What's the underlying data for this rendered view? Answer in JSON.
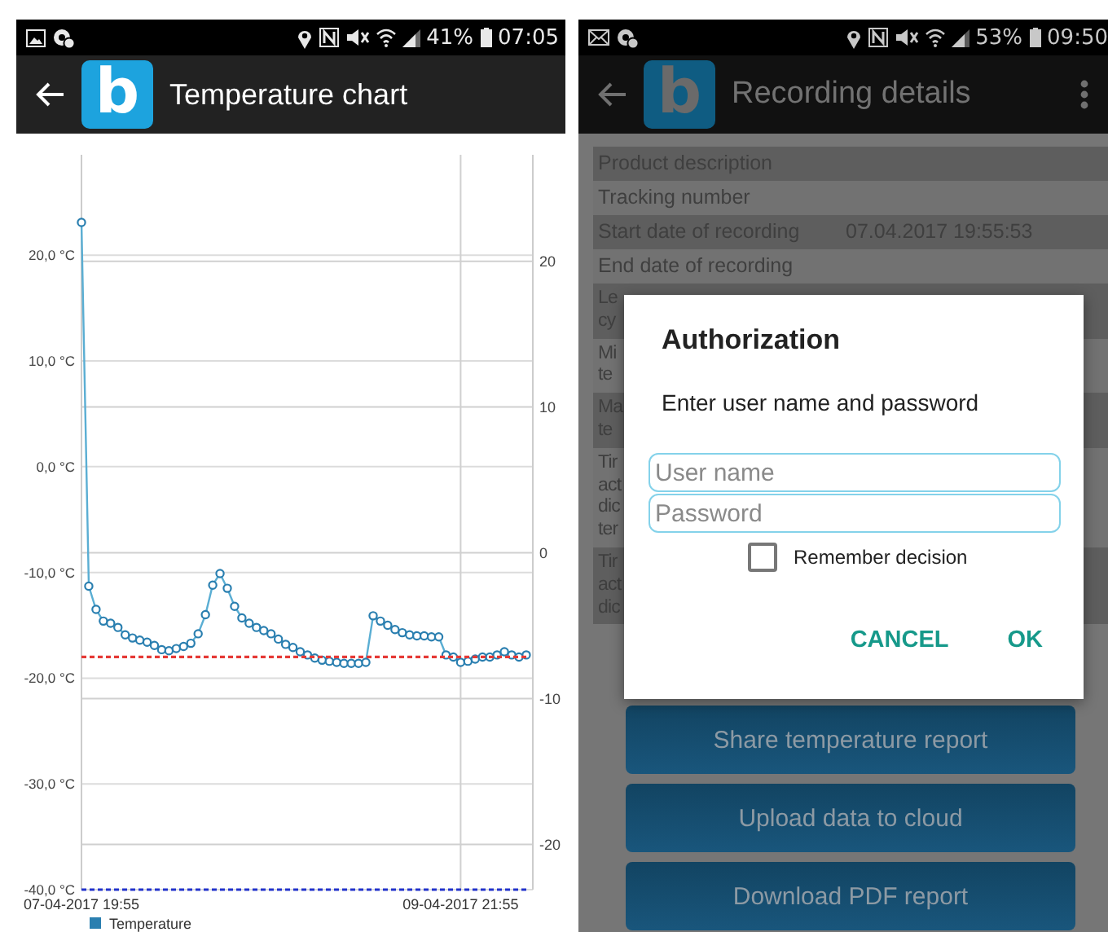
{
  "screens": [
    {
      "kind": "chart",
      "status_bar": {
        "battery": "41%",
        "time": "07:05"
      },
      "app_bar": {
        "title": "Temperature chart",
        "logo": "b"
      },
      "chart": {
        "chart_data": {
          "type": "line",
          "categories": [
            "07-04-2017 19:55",
            null,
            null,
            null,
            null,
            null,
            null,
            null,
            null,
            null,
            null,
            null,
            null,
            null,
            null,
            null,
            null,
            null,
            null,
            null,
            null,
            null,
            null,
            null,
            null,
            null,
            null,
            null,
            null,
            null,
            null,
            null,
            null,
            null,
            null,
            null,
            null,
            null,
            null,
            null,
            null,
            null,
            null,
            null,
            null,
            null,
            null,
            null,
            null,
            null,
            null,
            null,
            "09-04-2017 21:55",
            null,
            null,
            null,
            null,
            null,
            null,
            null,
            null,
            null
          ],
          "series": [
            {
              "name": "Temperature",
              "color": "#2a7fb0",
              "marker": "circle",
              "line_style": "solid",
              "values": [
                23.1,
                -11.3,
                -13.5,
                -14.6,
                -14.8,
                -15.2,
                -15.9,
                -16.2,
                -16.4,
                -16.6,
                -16.9,
                -17.3,
                -17.4,
                -17.2,
                -17.0,
                -16.7,
                -15.8,
                -14.0,
                -11.2,
                -10.1,
                -11.5,
                -13.2,
                -14.3,
                -14.8,
                -15.2,
                -15.5,
                -15.8,
                -16.3,
                -16.8,
                -17.1,
                -17.5,
                -17.8,
                -18.1,
                -18.3,
                -18.4,
                -18.5,
                -18.6,
                -18.6,
                -18.6,
                -18.5,
                -14.1,
                -14.6,
                -15.0,
                -15.4,
                -15.7,
                -15.9,
                -16.0,
                -16.0,
                -16.1,
                -16.1,
                -17.8,
                -18.0,
                -18.5,
                -18.4,
                -18.2,
                -18.0,
                -18.0,
                -17.8,
                -17.5,
                -17.8,
                -18.0,
                -17.8
              ]
            },
            {
              "color": "#e53935",
              "line_style": "dashed",
              "values": [
                -18,
                -18,
                -18,
                -18,
                -18,
                -18,
                -18,
                -18,
                -18,
                -18,
                -18,
                -18,
                -18,
                -18,
                -18,
                -18,
                -18,
                -18,
                -18,
                -18,
                -18,
                -18,
                -18,
                -18,
                -18,
                -18,
                -18,
                -18,
                -18,
                -18,
                -18,
                -18,
                -18,
                -18,
                -18,
                -18,
                -18,
                -18,
                -18,
                -18,
                -18,
                -18,
                -18,
                -18,
                -18,
                -18,
                -18,
                -18,
                -18,
                -18,
                -18,
                -18,
                -18,
                -18,
                -18,
                -18,
                -18,
                -18,
                -18,
                -18,
                -18,
                -18
              ]
            },
            {
              "color": "#2233cc",
              "line_style": "dashed",
              "values": [
                -40,
                -40,
                -40,
                -40,
                -40,
                -40,
                -40,
                -40,
                -40,
                -40,
                -40,
                -40,
                -40,
                -40,
                -40,
                -40,
                -40,
                -40,
                -40,
                -40,
                -40,
                -40,
                -40,
                -40,
                -40,
                -40,
                -40,
                -40,
                -40,
                -40,
                -40,
                -40,
                -40,
                -40,
                -40,
                -40,
                -40,
                -40,
                -40,
                -40,
                -40,
                -40,
                -40,
                -40,
                -40,
                -40,
                -40,
                -40,
                -40,
                -40,
                -40,
                -40,
                -40,
                -40,
                -40,
                -40,
                -40,
                -40,
                -40,
                -40,
                -40,
                -40
              ]
            }
          ],
          "ylim": [
            -40,
            29.5
          ],
          "yticks": [
            {
              "value": 20,
              "label": "20,0 °C"
            },
            {
              "value": 10,
              "label": "10,0 °C"
            },
            {
              "value": 0,
              "label": "0,0 °C"
            },
            {
              "value": -10,
              "label": "-10,0 °C"
            },
            {
              "value": -20,
              "label": "-20,0 °C"
            },
            {
              "value": -30,
              "label": "-30,0 °C"
            },
            {
              "value": -40,
              "label": "-40,0 °C"
            }
          ],
          "y2lim": [
            -23.1,
            27.3
          ],
          "y2ticks": [
            {
              "value": 20,
              "label": "20"
            },
            {
              "value": 10,
              "label": "10"
            },
            {
              "value": 0,
              "label": "0"
            },
            {
              "value": -10,
              "label": "-10"
            },
            {
              "value": -20,
              "label": "-20"
            }
          ],
          "grid": true
        }
      }
    },
    {
      "kind": "details",
      "status_bar": {
        "battery": "53%",
        "time": "09:50"
      },
      "app_bar": {
        "title": "Recording details",
        "logo": "b"
      },
      "rows": [
        {
          "label": "Product description",
          "shaded": true
        },
        {
          "label": "Tracking number",
          "shaded": false
        },
        {
          "label": "Start date of recording",
          "value": "07.04.2017 19:55:53",
          "shaded": true
        },
        {
          "label": "End date of recording",
          "shaded": false
        },
        {
          "label": "Le\ncy",
          "shaded": true
        },
        {
          "label": "Mi\nte",
          "shaded": false
        },
        {
          "label": "Ma\nte",
          "shaded": true
        },
        {
          "label": "Tir\nact\ndic\nter",
          "shaded": false
        },
        {
          "label": "Tir\nact\ndic",
          "shaded": true
        }
      ],
      "dialog": {
        "title": "Authorization",
        "message": "Enter user name and password",
        "fields": [
          {
            "placeholder": "User name"
          },
          {
            "placeholder": "Password"
          }
        ],
        "checkbox": {
          "label": "Remember decision",
          "checked": false
        },
        "actions": [
          "CANCEL",
          "OK"
        ]
      },
      "buttons": [
        "Share temperature report",
        "Upload data to cloud",
        "Download PDF report"
      ]
    }
  ]
}
